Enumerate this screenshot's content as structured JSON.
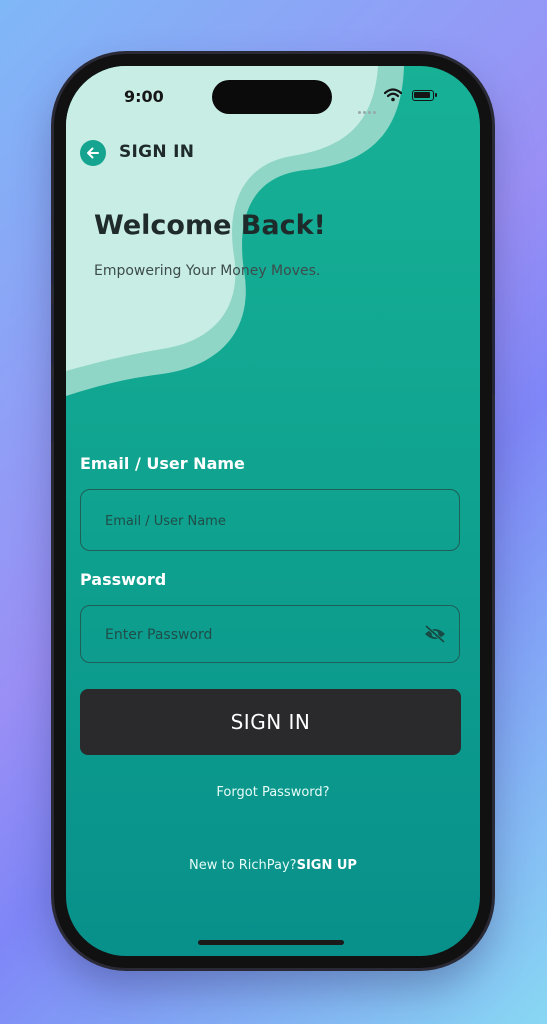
{
  "status_bar": {
    "time": "9:00"
  },
  "header": {
    "title": "SIGN IN"
  },
  "hero": {
    "title": "Welcome Back!",
    "subtitle": "Empowering Your Money Moves."
  },
  "form": {
    "email_label": "Email / User Name",
    "email_placeholder": "Email / User Name",
    "email_value": "",
    "password_label": "Password",
    "password_placeholder": "Enter Password",
    "password_value": "",
    "submit_label": "SIGN IN"
  },
  "links": {
    "forgot_password": "Forgot Password?",
    "signup_prompt": "New to RichPay?",
    "signup_link": "SIGN UP"
  },
  "icons": {
    "back": "arrow-left-icon",
    "password_toggle": "eye-off-icon",
    "wifi": "wifi-icon",
    "battery": "battery-icon"
  },
  "colors": {
    "accent_teal": "#15a48f",
    "background_teal": "#0f9f8d",
    "wave_light": "#c6ece4",
    "button_dark": "#2a2a2c"
  }
}
